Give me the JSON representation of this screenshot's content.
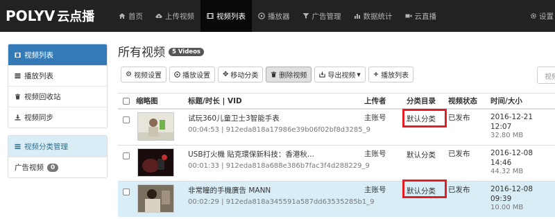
{
  "logo": {
    "brand": "POLYV",
    "cn": "云点播"
  },
  "nav": {
    "items": [
      {
        "label": "首页",
        "icon": "home-icon"
      },
      {
        "label": "上传视频",
        "icon": "cloud-upload-icon"
      },
      {
        "label": "视频列表",
        "icon": "film-icon"
      },
      {
        "label": "播放器",
        "icon": "play-circle-icon"
      },
      {
        "label": "广告管理",
        "icon": "filter-icon"
      },
      {
        "label": "数据统计",
        "icon": "bar-chart-icon"
      },
      {
        "label": "云直播",
        "icon": "video-camera-icon"
      }
    ],
    "settings_label": "设置"
  },
  "sidebar": {
    "group1": [
      {
        "label": "视频列表",
        "icon": "film-icon"
      },
      {
        "label": "播放列表",
        "icon": "list-icon"
      },
      {
        "label": "视频回收站",
        "icon": "trash-icon"
      },
      {
        "label": "视频同步",
        "icon": "download-icon"
      }
    ],
    "group2": {
      "header": "视频分类管理",
      "ad_label": "广告视频",
      "ad_count": "0"
    }
  },
  "main": {
    "title": "所有视频",
    "count_badge": "5 Videos",
    "search_placeholder": "视频",
    "toolbar": {
      "video_settings": "视频设置",
      "player_settings": "播放设置",
      "move_category": "移动分类",
      "delete_video": "删除视频",
      "export_video": "导出视频",
      "add_playlist": "播放列表"
    }
  },
  "table": {
    "headers": {
      "thumb": "缩略图",
      "title": "标题/时长 | VID",
      "uploader": "上传者",
      "category": "分类目录",
      "status": "视频状态",
      "time_size": "时间/大小"
    },
    "rows": [
      {
        "title": "试玩360儿童卫士3智能手表",
        "meta": "00:04:53 | 912eda818a17986e39b06f02bf8d3285_9",
        "uploader": "主账号",
        "category": "默认分类",
        "status": "已发布",
        "date": "2016-12-21",
        "time": "12:07",
        "size": "32.80 MB"
      },
      {
        "title": "USB打火機 貼克環保新科技：香港秋...",
        "meta": "00:01:33 | 912eda818a688e386b7fac3f4d288229_9",
        "uploader": "主账号",
        "category": "默认分类",
        "status": "已发布",
        "date": "2016-12-08",
        "time": "14:46",
        "size": "44.32 MB"
      },
      {
        "title": "非常瞳的手機廣告 MANN",
        "meta": "00:02:29 | 912eda818a345591a587dd63535285b1_9",
        "uploader": "主账号",
        "category": "默认分类",
        "status": "已发布",
        "date": "2016-12-08",
        "time": "09:39",
        "size": "10.00 MB"
      }
    ]
  }
}
